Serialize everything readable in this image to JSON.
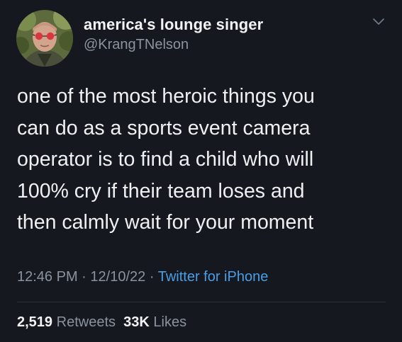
{
  "author": {
    "display_name": "america's lounge singer",
    "handle": "@KrangTNelson",
    "avatar_icon": "profile-photo"
  },
  "menu_icon": "chevron-down-icon",
  "tweet": {
    "text": "one of the most heroic things you\ncan do as a sports event camera\noperator is to find a child who will\n100% cry if their team loses and\nthen calmly wait for your moment",
    "time": "12:46 PM",
    "date": "12/10/22",
    "source": "Twitter for iPhone",
    "separator": "·"
  },
  "stats": {
    "retweets_count": "2,519",
    "retweets_label": "Retweets",
    "likes_count": "33K",
    "likes_label": "Likes"
  },
  "colors": {
    "background": "#15181f",
    "text": "#eef0f2",
    "secondary": "#8a949e",
    "link": "#4a9ee6"
  }
}
